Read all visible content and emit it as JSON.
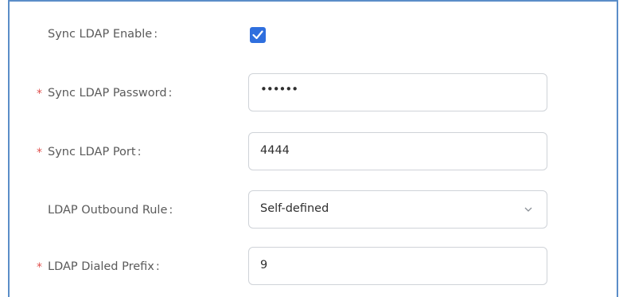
{
  "form": {
    "sync_enable": {
      "label": "Sync LDAP Enable",
      "colon": ":",
      "checked": true
    },
    "sync_password": {
      "required_mark": "*",
      "label": "Sync LDAP Password",
      "colon": ":",
      "value": "••••••"
    },
    "sync_port": {
      "required_mark": "*",
      "label": "Sync LDAP Port",
      "colon": ":",
      "value": "4444"
    },
    "outbound_rule": {
      "label": "LDAP Outbound Rule",
      "colon": ":",
      "selected": "Self-defined"
    },
    "dialed_prefix": {
      "required_mark": "*",
      "label": "LDAP Dialed Prefix",
      "colon": ":",
      "value": "9"
    }
  },
  "icons": {
    "check": "check-icon",
    "chevron": "chevron-down-icon"
  },
  "colors": {
    "accent": "#2f6fde",
    "required": "#e0504d",
    "frame_border": "#5b8dc8"
  }
}
